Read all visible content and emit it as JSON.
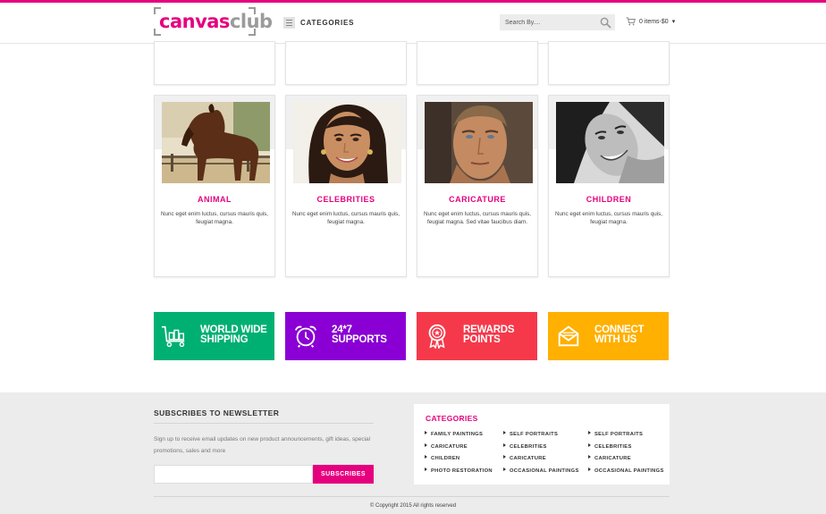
{
  "brand": {
    "logo_part1": "canvas",
    "logo_part2": "club",
    "accent_color": "#e6007e"
  },
  "header": {
    "categories_label": "CATEGORIES",
    "search_placeholder": "Search By....",
    "cart_label": "0 items-$0",
    "cart_caret": "▾"
  },
  "products": [
    {
      "title": "ANIMAL",
      "description": "Nunc eget enim luctus, cursus mauris quis, feugiat magna.",
      "image": "horse-portrait-painting"
    },
    {
      "title": "CELEBRITIES",
      "description": "Nunc eget enim luctus, cursus mauris quis, feugiat magna.",
      "image": "woman-portrait-painting"
    },
    {
      "title": "CARICATURE",
      "description": "Nunc eget enim luctus, cursus mauris quis, feugiat magna. Sed vitae faucibus diam.",
      "image": "man-portrait-painting"
    },
    {
      "title": "CHILDREN",
      "description": "Nunc eget enim luctus, cursus mauris quis, feugiat magna.",
      "image": "bw-portrait-painting"
    }
  ],
  "features": [
    {
      "label_line1": "WORLD WIDE",
      "label_line2": "SHIPPING",
      "color": "#00b072",
      "icon": "shipping-cart-icon"
    },
    {
      "label_line1": "24*7",
      "label_line2": "SUPPORTS",
      "color": "#8a00d4",
      "icon": "alarm-clock-icon"
    },
    {
      "label_line1": "REWARDS",
      "label_line2": "POINTS",
      "color": "#f5394b",
      "icon": "award-ribbon-icon"
    },
    {
      "label_line1": "CONNECT",
      "label_line2": "WITH US",
      "color": "#ffb000",
      "icon": "envelope-icon"
    }
  ],
  "newsletter": {
    "title": "SUBSCRIBES TO NEWSLETTER",
    "text": "Sign up to receive email updates on new product announcements, gift ideas, special promotions, sales and more",
    "input_placeholder": "",
    "button_label": "SUBSCRIBES"
  },
  "footer_categories": {
    "title": "CATEGORIES",
    "columns": [
      [
        "FAMILY PAINTINGS",
        "CARICATURE",
        "CHILDREN",
        "PHOTO RESTORATION"
      ],
      [
        "SELF PORTRAITS",
        "CELEBRITIES",
        "CARICATURE",
        "OCCASIONAL PAINTINGS"
      ],
      [
        "SELF PORTRAITS",
        "CELEBRITIES",
        "CARICATURE",
        "OCCASIONAL PAINTINGS"
      ]
    ]
  },
  "copyright": "© Copyright 2015 All rights reserved"
}
